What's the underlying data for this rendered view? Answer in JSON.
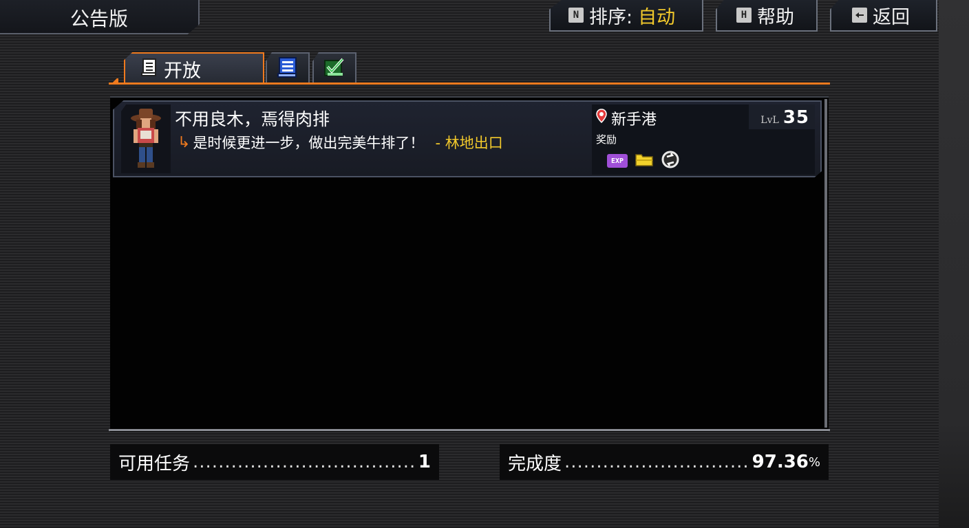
{
  "header": {
    "title": "公告版",
    "sort": {
      "key": "N",
      "label": "排序:",
      "value": "自动"
    },
    "help": {
      "key": "H",
      "label": "帮助"
    },
    "back": {
      "label": "返回"
    }
  },
  "tabs": {
    "open": {
      "label": "开放",
      "icon": "scroll-icon"
    },
    "list": {
      "icon": "notebook-icon"
    },
    "done": {
      "icon": "checkmark-icon"
    }
  },
  "quests": [
    {
      "title": "不用良木，焉得肉排",
      "description": "是时候更进一步，做出完美牛排了！",
      "location": "- 林地出口",
      "place": "新手港",
      "level_label": "LvL",
      "level": "35",
      "reward_label": "奖励",
      "rewards": [
        {
          "icon": "exp-icon",
          "text": "EXP"
        },
        {
          "icon": "card-icon"
        },
        {
          "icon": "cycle-icon"
        }
      ]
    }
  ],
  "footer": {
    "available_label": "可用任务",
    "available_value": "1",
    "completion_label": "完成度",
    "completion_value": "97.36",
    "completion_unit": "%"
  },
  "colors": {
    "accent": "#f07a1e",
    "highlight": "#f2c92b",
    "exp": "#a04fd8"
  }
}
